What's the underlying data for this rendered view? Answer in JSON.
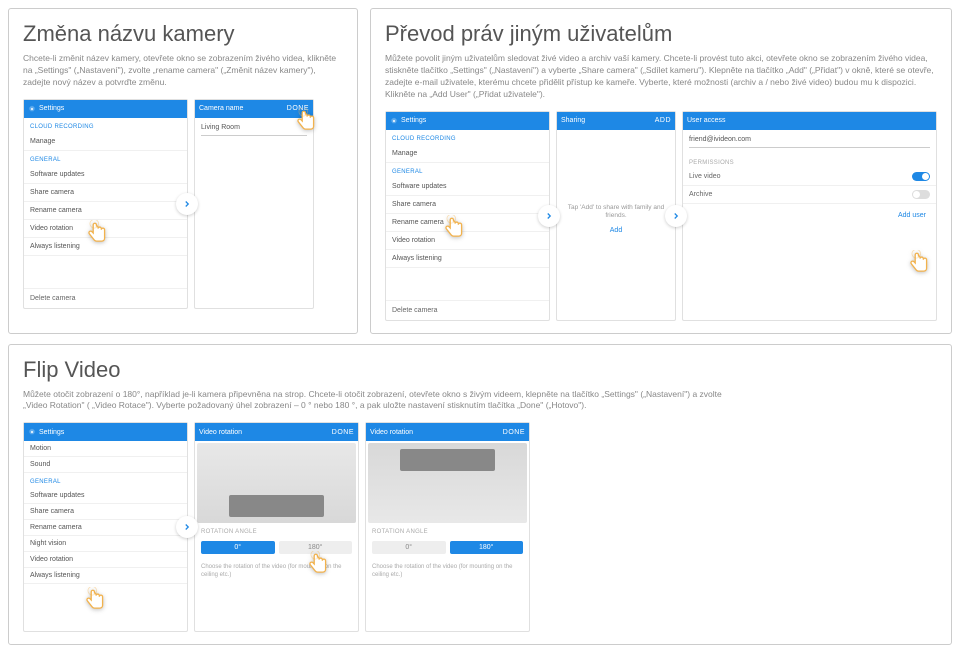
{
  "rename": {
    "title": "Změna názvu kamery",
    "desc": "Chcete-li změnit název kamery, otevřete okno se zobrazením živého videa, klikněte na „Settings\" („Nastavení\"), zvolte „rename camera\" („Změnit název kamery\"), zadejte nový název a potvrďte změnu.",
    "settings_bar": "Settings",
    "camera_name_bar": "Camera name",
    "done": "DONE",
    "value": "Living Room"
  },
  "transfer": {
    "title": "Převod práv jiným uživatelům",
    "desc": "Můžete povolit jiným uživatelům sledovat živé video a archiv vaší kamery. Chcete-li provést tuto akci, otevřete okno se zobrazením živého videa, stiskněte tlačítko „Settings\" („Nastavení\") a vyberte „Share camera\" („Sdílet kameru\"). Klepněte na tlačítko „Add\" („Přidat\") v okně, které se otevře, zadejte e-mail uživatele, kterému chcete přidělit přístup ke kameře. Vyberte, které možnosti (archiv a / nebo živé video) budou mu k dispozici. Klikněte na „Add User\" („Přidat uživatele\").",
    "sharing_bar": "Sharing",
    "add": "ADD",
    "user_access_bar": "User access",
    "tap_hint": "Tap 'Add' to share with family and friends.",
    "add_link": "Add",
    "email": "friend@ivideon.com",
    "perm_label": "PERMISSIONS",
    "live_video": "Live video",
    "archive": "Archive",
    "add_user": "Add user"
  },
  "settings": {
    "cloud_rec": "CLOUD RECORDING",
    "manage": "Manage",
    "general": "GENERAL",
    "software_updates": "Software updates",
    "share_camera": "Share camera",
    "rename_camera": "Rename camera",
    "video_rotation": "Video rotation",
    "night_vision": "Night vision",
    "always_listening": "Always listening",
    "delete_camera": "Delete camera",
    "motion": "Motion",
    "sound": "Sound"
  },
  "flip": {
    "title": "Flip Video",
    "desc": "Můžete otočit zobrazení o 180°, například je-li kamera připevněna na strop. Chcete-li otočit zobrazení, otevřete okno s živým videem, klepněte na tlačítko „Settings\" („Nastavení\") a zvolte „Video Rotation\" ( „Video Rotace\"). Vyberte požadovaný úhel zobrazení – 0 ° nebo 180 °, a pak uložte nastavení stisknutím tlačítka „Done\" („Hotovo\").",
    "video_rotation_bar": "Video rotation",
    "rotation_angle": "ROTATION ANGLE",
    "deg0": "0°",
    "deg180": "180°",
    "choose": "Choose the rotation of the video (for mounting on the ceiling etc.)"
  }
}
